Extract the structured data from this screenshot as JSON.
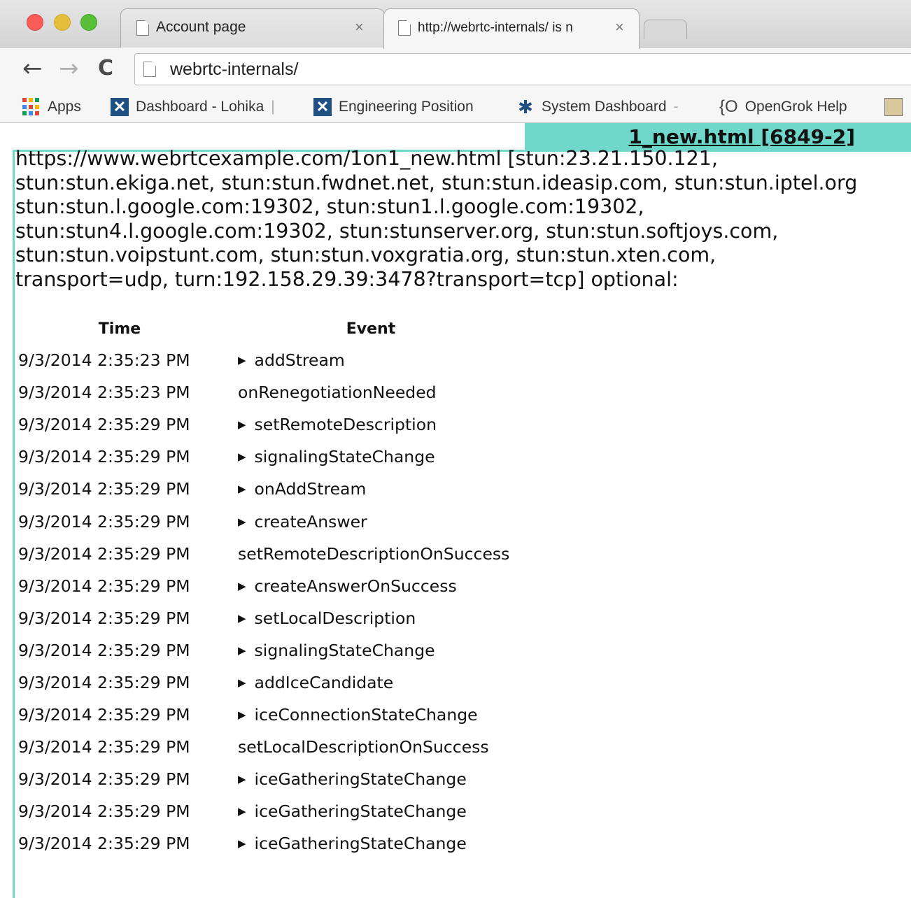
{
  "browser": {
    "tabs": [
      {
        "title": "Account page",
        "close": "×",
        "active": false
      },
      {
        "title": "http://webrtc-internals/ is n",
        "close": "×",
        "active": true
      }
    ],
    "nav": {
      "back": "←",
      "forward": "→",
      "reload": "C"
    },
    "address": "webrtc-internals/",
    "bookmarks": [
      {
        "label": "Apps",
        "icon": "apps-grid-icon"
      },
      {
        "label": "Dashboard - Lohika",
        "trail": "|",
        "icon": "jira-icon"
      },
      {
        "label": "Engineering Position",
        "icon": "jira-icon"
      },
      {
        "label": "System Dashboard",
        "trail": "-",
        "icon": "system-dashboard-icon"
      },
      {
        "label": "OpenGrok Help",
        "icon": "opengrok-icon"
      }
    ]
  },
  "page": {
    "tab_header": "1_new.html [6849-2]",
    "peer_connection_title": [
      "https://www.webrtcexample.com/1on1_new.html [stun:23.21.150.121,",
      "stun:stun.ekiga.net, stun:stun.fwdnet.net, stun:stun.ideasip.com, stun:stun.iptel.org",
      "stun:stun.l.google.com:19302, stun:stun1.l.google.com:19302,",
      "stun:stun4.l.google.com:19302, stun:stunserver.org, stun:stun.softjoys.com,",
      "stun:stun.voipstunt.com, stun:stun.voxgratia.org, stun:stun.xten.com,",
      "transport=udp, turn:192.158.29.39:3478?transport=tcp] optional:"
    ],
    "table": {
      "headers": {
        "time": "Time",
        "event": "Event"
      },
      "rows": [
        {
          "time": "9/3/2014 2:35:23 PM",
          "event": "addStream",
          "expandable": true
        },
        {
          "time": "9/3/2014 2:35:23 PM",
          "event": "onRenegotiationNeeded",
          "expandable": false
        },
        {
          "time": "9/3/2014 2:35:29 PM",
          "event": "setRemoteDescription",
          "expandable": true
        },
        {
          "time": "9/3/2014 2:35:29 PM",
          "event": "signalingStateChange",
          "expandable": true
        },
        {
          "time": "9/3/2014 2:35:29 PM",
          "event": "onAddStream",
          "expandable": true
        },
        {
          "time": "9/3/2014 2:35:29 PM",
          "event": "createAnswer",
          "expandable": true
        },
        {
          "time": "9/3/2014 2:35:29 PM",
          "event": "setRemoteDescriptionOnSuccess",
          "expandable": false
        },
        {
          "time": "9/3/2014 2:35:29 PM",
          "event": "createAnswerOnSuccess",
          "expandable": true
        },
        {
          "time": "9/3/2014 2:35:29 PM",
          "event": "setLocalDescription",
          "expandable": true
        },
        {
          "time": "9/3/2014 2:35:29 PM",
          "event": "signalingStateChange",
          "expandable": true
        },
        {
          "time": "9/3/2014 2:35:29 PM",
          "event": "addIceCandidate",
          "expandable": true
        },
        {
          "time": "9/3/2014 2:35:29 PM",
          "event": "iceConnectionStateChange",
          "expandable": true
        },
        {
          "time": "9/3/2014 2:35:29 PM",
          "event": "setLocalDescriptionOnSuccess",
          "expandable": false
        },
        {
          "time": "9/3/2014 2:35:29 PM",
          "event": "iceGatheringStateChange",
          "expandable": true
        },
        {
          "time": "9/3/2014 2:35:29 PM",
          "event": "iceGatheringStateChange",
          "expandable": true
        },
        {
          "time": "9/3/2014 2:35:29 PM",
          "event": "iceGatheringStateChange",
          "expandable": true
        }
      ]
    }
  },
  "colors": {
    "accent": "#6fd8ca",
    "traffic_close": "#fc5b57",
    "traffic_min": "#e5bf3c",
    "traffic_max": "#57c038"
  },
  "glyphs": {
    "expand": "▶"
  }
}
